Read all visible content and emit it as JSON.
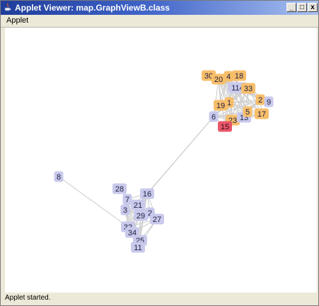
{
  "window": {
    "title": "Applet Viewer: map.GraphViewB.class"
  },
  "title_buttons": {
    "minimize": "_",
    "maximize": "□",
    "close": "x"
  },
  "menu": {
    "items": [
      "Applet"
    ]
  },
  "status": {
    "text": "Applet started."
  },
  "colors": {
    "node_default": "#c9c9ec",
    "node_orange": "#f7be6a",
    "node_selected": "#e8566a",
    "edge": "#cccccc"
  },
  "graph": {
    "nodes": [
      {
        "id": "30",
        "label": "30",
        "color": "orange"
      },
      {
        "id": "20",
        "label": "20",
        "color": "orange"
      },
      {
        "id": "4",
        "label": "4",
        "color": "orange"
      },
      {
        "id": "18",
        "label": "18",
        "color": "orange"
      },
      {
        "id": "114",
        "label": "114",
        "color": "default"
      },
      {
        "id": "33",
        "label": "33",
        "color": "orange"
      },
      {
        "id": "19",
        "label": "19",
        "color": "orange"
      },
      {
        "id": "1",
        "label": "1",
        "color": "orange"
      },
      {
        "id": "2a",
        "label": "2",
        "color": "orange"
      },
      {
        "id": "9",
        "label": "9",
        "color": "default"
      },
      {
        "id": "6",
        "label": "6",
        "color": "default"
      },
      {
        "id": "23",
        "label": "23",
        "color": "orange"
      },
      {
        "id": "13",
        "label": "13",
        "color": "default"
      },
      {
        "id": "5",
        "label": "5",
        "color": "orange"
      },
      {
        "id": "17",
        "label": "17",
        "color": "orange"
      },
      {
        "id": "15",
        "label": "15",
        "color": "selected"
      },
      {
        "id": "8",
        "label": "8",
        "color": "default"
      },
      {
        "id": "28",
        "label": "28",
        "color": "default"
      },
      {
        "id": "16",
        "label": "16",
        "color": "default"
      },
      {
        "id": "7",
        "label": "7",
        "color": "default"
      },
      {
        "id": "21",
        "label": "21",
        "color": "default"
      },
      {
        "id": "3",
        "label": "3",
        "color": "default"
      },
      {
        "id": "29",
        "label": "29",
        "color": "default"
      },
      {
        "id": "2b",
        "label": "2",
        "color": "default"
      },
      {
        "id": "27",
        "label": "27",
        "color": "default"
      },
      {
        "id": "32",
        "label": "32",
        "color": "default"
      },
      {
        "id": "34",
        "label": "34",
        "color": "default"
      },
      {
        "id": "25",
        "label": "25",
        "color": "default"
      },
      {
        "id": "11",
        "label": "11",
        "color": "default"
      }
    ]
  }
}
